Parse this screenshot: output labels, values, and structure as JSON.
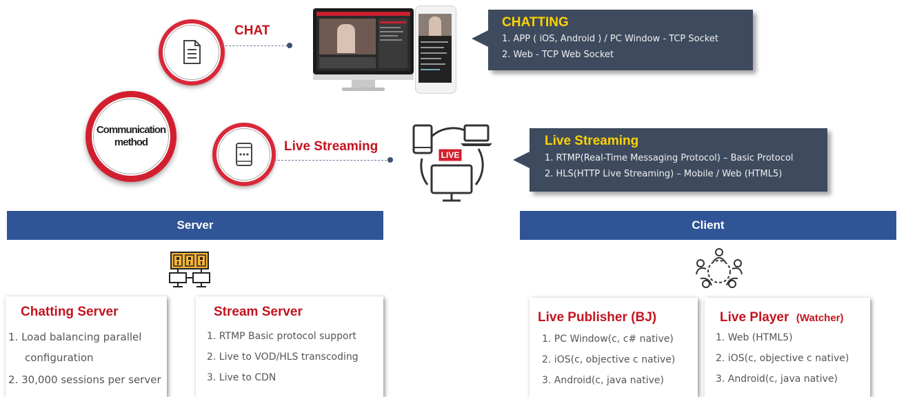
{
  "left": {
    "chat_label": "CHAT",
    "communication_method": [
      "Communication",
      "method"
    ],
    "live_label": "Live Streaming"
  },
  "callout_chat": {
    "title": "CHATTING",
    "lines": [
      "1. APP ( iOS, Android ) / PC Window - TCP Socket",
      "2. Web - TCP Web Socket"
    ]
  },
  "callout_live": {
    "title": "Live Streaming",
    "lines": [
      "1. RTMP(Real-Time Messaging Protocol) – Basic Protocol",
      "2. HLS(HTTP Live Streaming) – Mobile / Web (HTML5)"
    ]
  },
  "live_badge": "LIVE",
  "server": {
    "bar_label": "Server",
    "chatting": {
      "title": "Chatting Server",
      "lines": [
        "1.  Load balancing parallel",
        "configuration",
        "2. 30,000 sessions per server"
      ]
    },
    "stream": {
      "title": "Stream Server",
      "lines": [
        "1. RTMP Basic protocol support",
        "2. Live to VOD/HLS transcoding",
        "3. Live to CDN"
      ]
    }
  },
  "client": {
    "bar_label": "Client",
    "publisher": {
      "title": "Live Publisher (BJ)",
      "lines": [
        "1. PC Window(c, c# native)",
        "2. iOS(c, objective c native)",
        "3. Android(c, java native)"
      ]
    },
    "player": {
      "title": "Live Player",
      "subtitle": "(Watcher)",
      "lines": [
        "1. Web (HTML5)",
        "2. iOS(c, objective c native)",
        "3. Android(c, java native)"
      ]
    }
  },
  "icons": [
    "document-icon",
    "tablet-icon",
    "monitor-phone-mockup",
    "devices-live-icon",
    "server-icon",
    "people-circle-icon"
  ],
  "colors": {
    "red": "#c3141f",
    "navy_bar": "#2f5597",
    "callout_bg": "#3e4b5e",
    "callout_title": "#ffd200"
  }
}
